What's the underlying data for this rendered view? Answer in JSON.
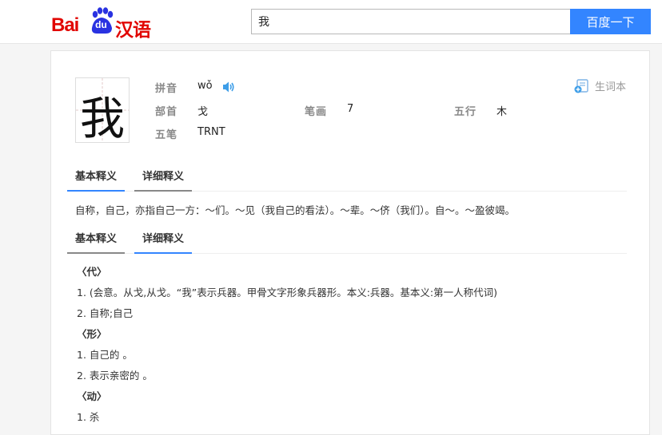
{
  "header": {
    "logo_bai": "Bai",
    "logo_du": "du",
    "logo_hanyu": "汉语",
    "search_value": "我",
    "search_button": "百度一下"
  },
  "entry": {
    "character": "我",
    "pinyin_label": "拼音",
    "pinyin": "wǒ",
    "radical_label": "部首",
    "radical": "戈",
    "strokes_label": "笔画",
    "strokes": "7",
    "wuxing_label": "五行",
    "wuxing": "木",
    "wubi_label": "五笔",
    "wubi": "TRNT",
    "vocab_label": "生词本"
  },
  "tabs1": {
    "basic": "基本释义",
    "detail": "详细释义"
  },
  "basic_text": "自称，自己，亦指自己一方：～们。～见（我自己的看法）。～辈。～侪（我们）。自～。～盈彼竭。",
  "tabs2": {
    "basic": "基本释义",
    "detail": "详细释义"
  },
  "detail_rows": [
    {
      "text": "〈代〉",
      "pos": true
    },
    {
      "text": "1. (会意。从戈,从戈。“我”表示兵器。甲骨文字形象兵器形。本义:兵器。基本义:第一人称代词)",
      "pos": false
    },
    {
      "text": "2. 自称;自己",
      "pos": false
    },
    {
      "text": "〈形〉",
      "pos": true
    },
    {
      "text": "1. 自己的 。",
      "pos": false
    },
    {
      "text": "2. 表示亲密的 。",
      "pos": false
    },
    {
      "text": "〈动〉",
      "pos": true
    },
    {
      "text": "1. 杀",
      "pos": false
    }
  ],
  "colors": {
    "brand_red": "#e10602",
    "accent_blue": "#3385ff"
  },
  "icons": {
    "speaker": "speaker-icon",
    "vocab": "vocabulary-book-icon"
  }
}
